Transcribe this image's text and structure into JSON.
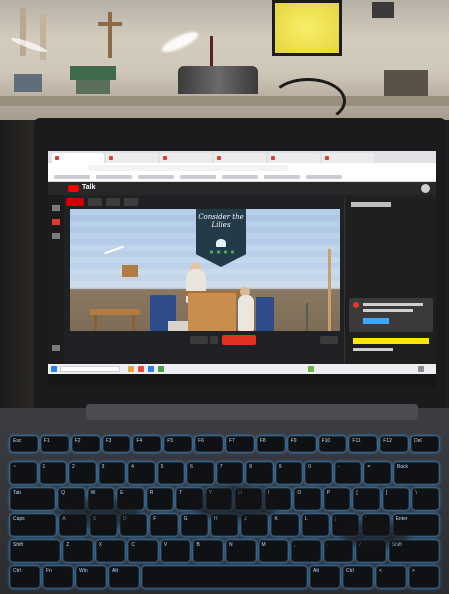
{
  "photo": {
    "subject": "",
    "app": {
      "logo_text": "Talk"
    },
    "stream": {
      "banner_text": "Consider the Lilies"
    },
    "keys": {
      "row1": [
        "Esc",
        "F1",
        "F2",
        "F3",
        "F4",
        "F5",
        "F6",
        "F7",
        "F8",
        "F9",
        "F10",
        "F11",
        "F12",
        "Del"
      ],
      "row2": [
        "~",
        "1",
        "2",
        "3",
        "4",
        "5",
        "6",
        "7",
        "8",
        "9",
        "0",
        "-",
        "=",
        "Back"
      ],
      "row3": [
        "Tab",
        "Q",
        "W",
        "E",
        "R",
        "T",
        "Y",
        "U",
        "I",
        "O",
        "P",
        "[",
        "]",
        "\\"
      ],
      "row4": [
        "Caps",
        "A",
        "S",
        "D",
        "F",
        "G",
        "H",
        "J",
        "K",
        "L",
        ";",
        "'",
        "Enter"
      ],
      "row5": [
        "Shift",
        "Z",
        "X",
        "C",
        "V",
        "B",
        "N",
        "M",
        ",",
        ".",
        "/",
        "Shift"
      ],
      "row6": [
        "Ctrl",
        "Fn",
        "Win",
        "Alt",
        "",
        "Alt",
        "Ctrl",
        "<",
        ">"
      ]
    },
    "colors": {
      "keyboard_backlight": "#3ea6ff",
      "live_red": "#e0321f",
      "chat_highlight": "#ffe600"
    }
  }
}
